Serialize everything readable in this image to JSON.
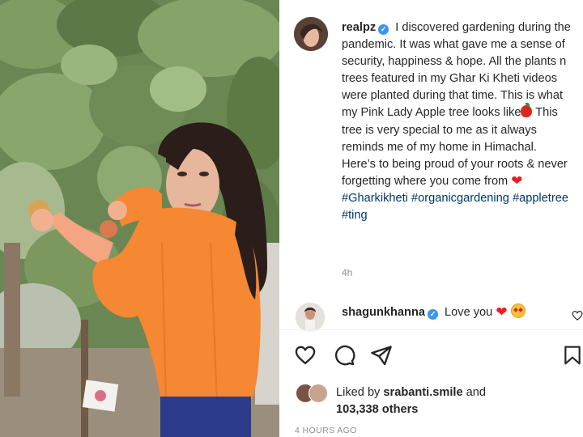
{
  "post": {
    "username": "realpz",
    "verified_mark": "✓",
    "caption_part1": "I discovered gardening during the pandemic. It was what gave me a sense of security, happiness & hope. All the plants n trees featured in my Ghar Ki Kheti videos were planted during that time. This is what my Pink Lady Apple tree looks like",
    "caption_part2": "This tree is very special to me as it always reminds me of my home in Himachal. Here’s to being proud of your roots & never forgetting where you come from",
    "hashtags": [
      "#Gharkikheti",
      "#organicgardening",
      "#appletree",
      "#ting"
    ],
    "relative_time": "4h",
    "apple_emoji": "apple-emoji",
    "heart_emoji": "❤"
  },
  "comment": {
    "username": "shagunkhanna",
    "verified_mark": "✓",
    "text": "Love you",
    "heart_emoji": "❤",
    "second_emoji": "star-struck-emoji"
  },
  "actions": {
    "like_icon": "heart-icon",
    "comment_icon": "comment-icon",
    "share_icon": "share-icon",
    "save_icon": "bookmark-icon"
  },
  "likes": {
    "prefix": "Liked by",
    "liker": "srabanti.smile",
    "joiner": "and",
    "others": "103,338 others"
  },
  "date": "4 HOURS AGO",
  "colors": {
    "link": "#00376b",
    "verified": "#3897f0",
    "secondary_text": "#8e8e8e",
    "sweater": "#f68733"
  }
}
